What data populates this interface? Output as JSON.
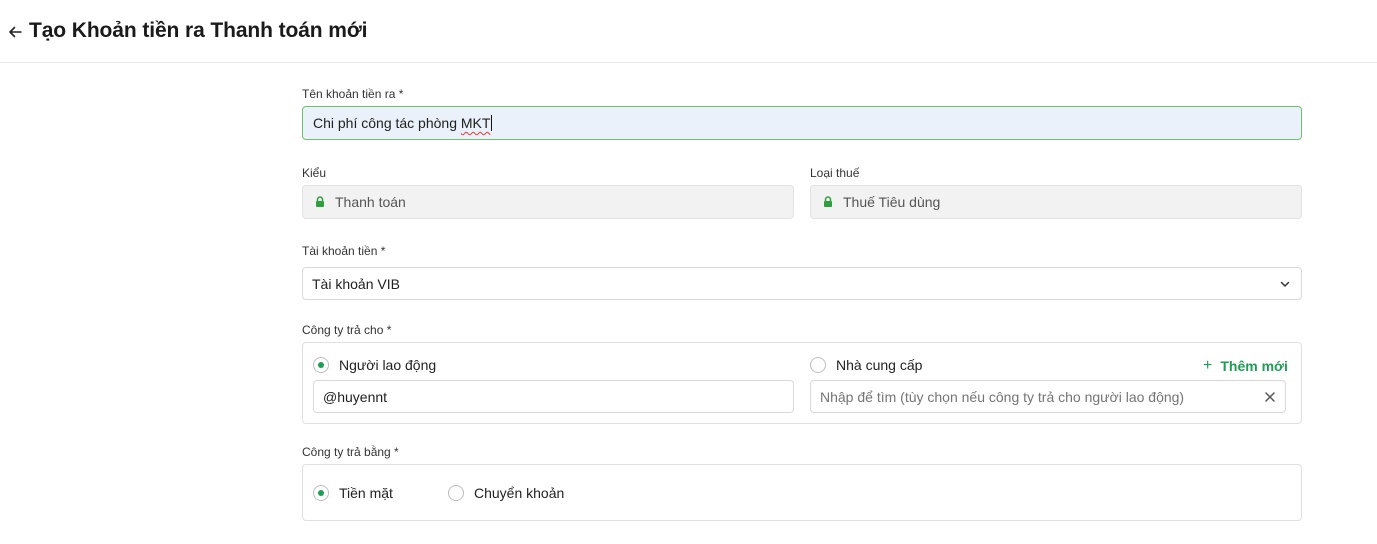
{
  "header": {
    "title": "Tạo Khoản tiền ra Thanh toán mới"
  },
  "form": {
    "name": {
      "label": "Tên khoản tiền ra *",
      "value_prefix": "Chi phí công tác phòng ",
      "value_flagged": "MKT"
    },
    "type": {
      "label": "Kiểu",
      "value": "Thanh toán"
    },
    "tax_type": {
      "label": "Loại thuế",
      "value": "Thuế Tiêu dùng"
    },
    "account": {
      "label": "Tài khoản tiền *",
      "selected": "Tài khoản VIB"
    },
    "pay_to": {
      "label": "Công ty trả cho *",
      "options": [
        {
          "label": "Người lao động",
          "checked": true
        },
        {
          "label": "Nhà cung cấp",
          "checked": false
        }
      ],
      "add_new_label": "Thêm mới",
      "employee_value": "@huyennt",
      "supplier_placeholder": "Nhập để tìm (tùy chọn nếu công ty trả cho người lao động)"
    },
    "pay_by": {
      "label": "Công ty trả bằng *",
      "options": [
        {
          "label": "Tiền mặt",
          "checked": true
        },
        {
          "label": "Chuyển khoản",
          "checked": false
        }
      ]
    }
  },
  "colors": {
    "accent": "#1f9d55",
    "active_border": "#6cc26c",
    "active_bg": "#eaf1fb",
    "locked_bg": "#f2f2f2",
    "spellcheck": "#e53935"
  }
}
